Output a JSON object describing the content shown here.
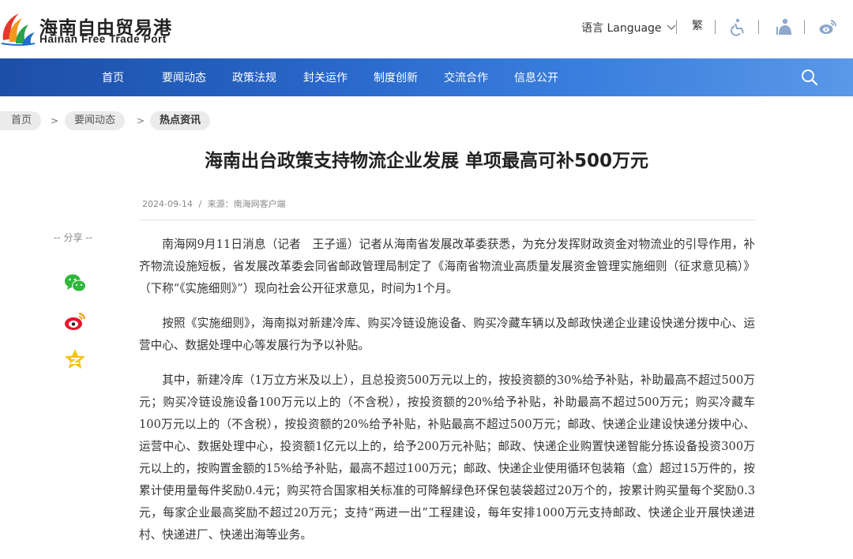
{
  "header": {
    "logo_cn": "海南自由贸易港",
    "logo_en": "Hainan Free Trade Port",
    "language_label": "语言 Language",
    "traditional_label": "繁",
    "icons": [
      "accessibility-icon",
      "elderly-mode-icon",
      "weibo-icon"
    ]
  },
  "nav": {
    "items": [
      "首页",
      "要闻动态",
      "政策法规",
      "封关运作",
      "制度创新",
      "交流合作",
      "信息公开"
    ],
    "search_icon": "search-icon"
  },
  "breadcrumb": {
    "items": [
      "首页",
      "要闻动态",
      "热点资讯"
    ],
    "separator": ">"
  },
  "article": {
    "title": "海南出台政策支持物流企业发展 单项最高可补500万元",
    "date": "2024-09-14",
    "meta_sep": "/",
    "source": "来源：南海网客户端",
    "share_label": "-- 分享 --",
    "share_icons": [
      "wechat-icon",
      "weibo-icon",
      "qzone-icon"
    ],
    "paragraphs": [
      "南海网9月11日消息（记者　王子遥）记者从海南省发展改革委获悉，为充分发挥财政资金对物流业的引导作用，补齐物流设施短板，省发展改革委会同省邮政管理局制定了《海南省物流业高质量发展资金管理实施细则（征求意见稿）》（下称“《实施细则》”）现向社会公开征求意见，时间为1个月。",
      "按照《实施细则》，海南拟对新建冷库、购买冷链设施设备、购买冷藏车辆以及邮政快递企业建设快递分拨中心、运营中心、数据处理中心等发展行为予以补贴。",
      "其中，新建冷库（1万立方米及以上），且总投资500万元以上的，按投资额的30%给予补贴，补助最高不超过500万元；购买冷链设施设备100万元以上的（不含税），按投资额的20%给予补贴，补助最高不超过500万元；购买冷藏车100万元以上的（不含税），按投资额的20%给予补贴，补贴最高不超过500万元；邮政、快递企业建设快递分拨中心、运营中心、数据处理中心，投资额1亿元以上的，给予200万元补贴；邮政、快递企业购置快递智能分拣设备投资300万元以上的，按购置金额的15%给予补贴，最高不超过100万元；邮政、快递企业使用循环包装箱（盒）超过15万件的，按累计使用量每件奖励0.4元；购买符合国家相关标准的可降解绿色环保包装袋超过20万个的，按累计购买量每个奖励0.3元，每家企业最高奖励不超过20万元；支持“两进一出”工程建设，每年安排1000万元支持邮政、快递企业开展快递进村、快递进厂、快递出海等业务。"
    ]
  }
}
